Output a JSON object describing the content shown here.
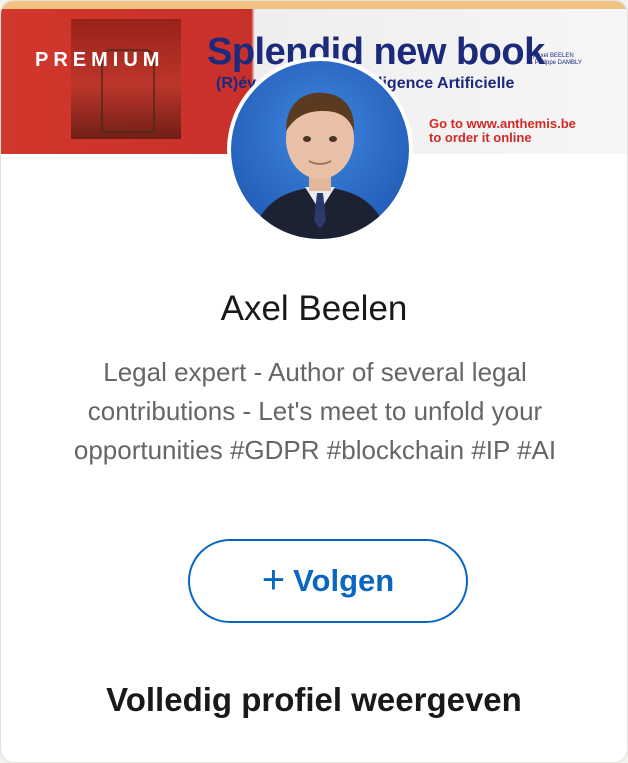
{
  "banner": {
    "premium_label": "PREMIUM",
    "book_title": "Splendid new book",
    "book_subtitle": "(R)évolution de l'Intelligence Artificielle",
    "authors_line1": "by Axel BEELEN",
    "authors_line2": "& Philippe DAMBLY",
    "cta_line1": "Go to www.anthemis.be",
    "cta_line2": "to order it online"
  },
  "profile": {
    "name": "Axel Beelen",
    "headline": "Legal expert - Author of several legal contributions - Let's meet to unfold your opportunities #GDPR #blockchain #IP #AI"
  },
  "actions": {
    "follow_icon": "+",
    "follow_label": "Volgen",
    "view_profile_label": "Volledig profiel weergeven"
  },
  "colors": {
    "accent": "#0a66c2",
    "premium_gold": "#f1c27d",
    "banner_red": "#c9302c"
  },
  "icons": {
    "follow": "plus-icon"
  }
}
